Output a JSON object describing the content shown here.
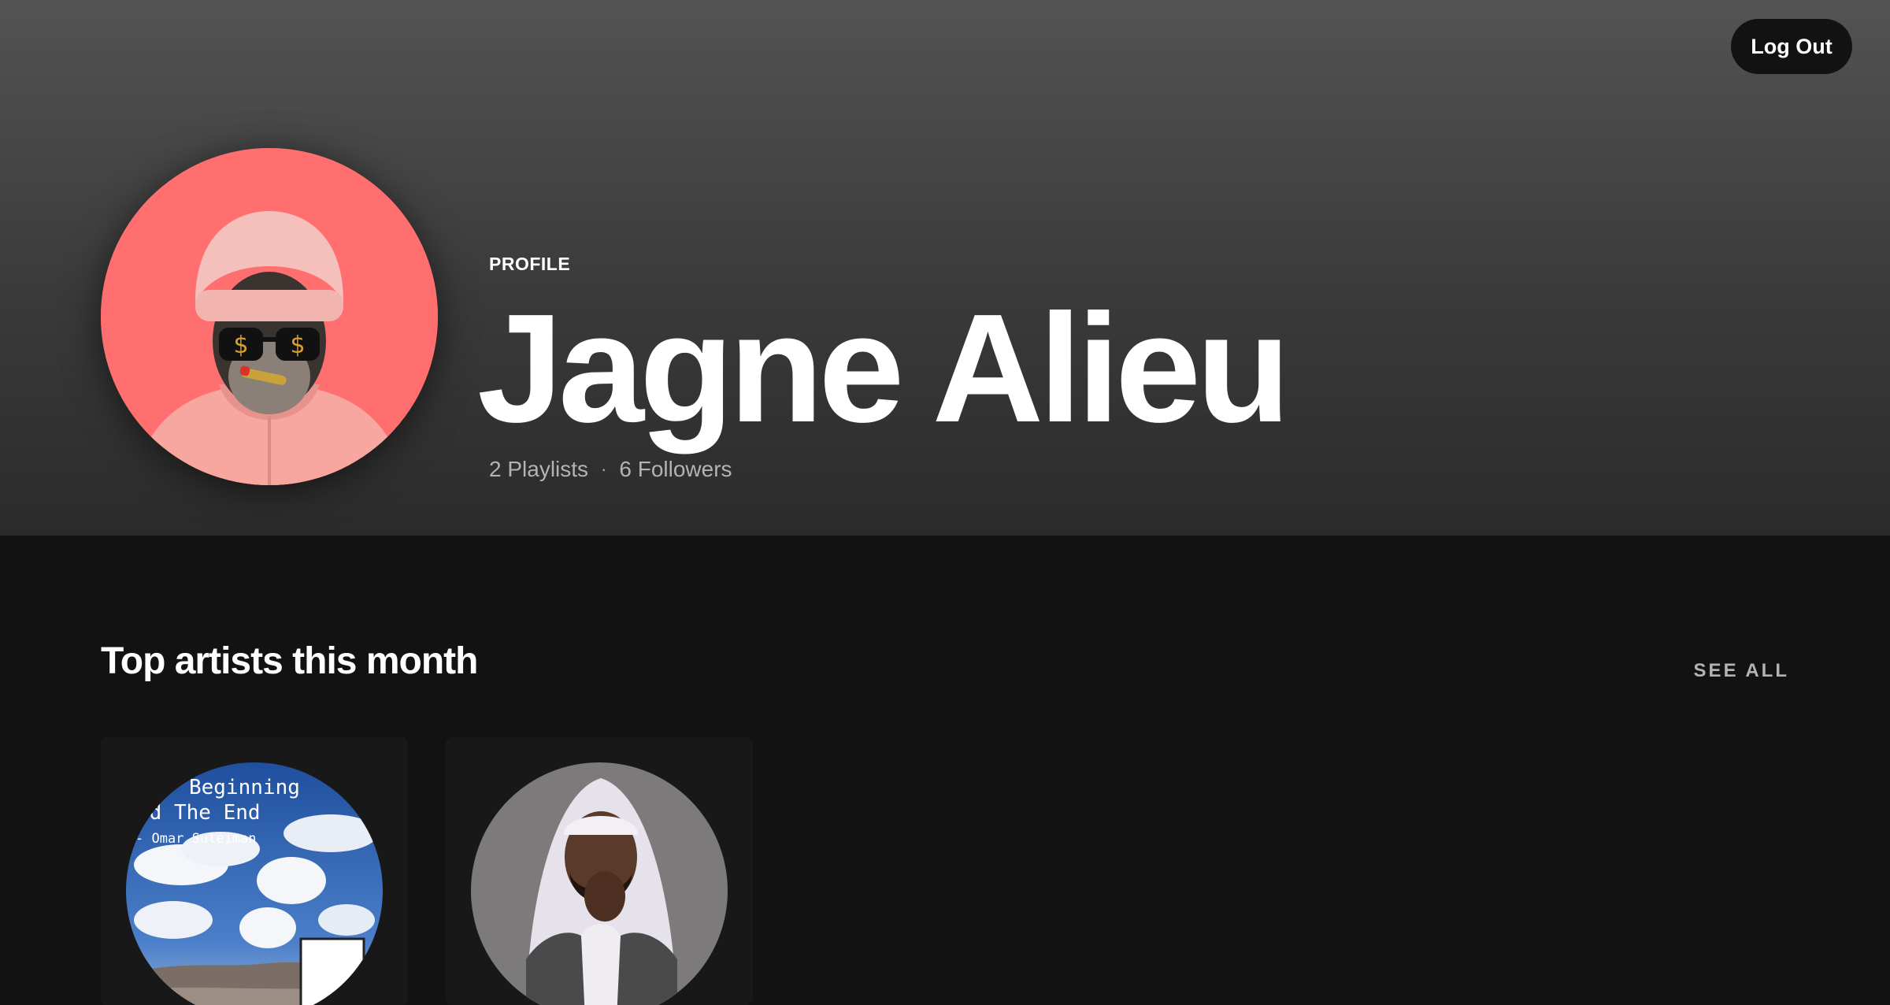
{
  "header": {
    "logout_label": "Log Out",
    "profile_label": "PROFILE",
    "name": "Jagne Alieu",
    "playlists": "2 Playlists",
    "separator": "·",
    "followers": "6 Followers"
  },
  "top_artists": {
    "title": "Top artists this month",
    "see_all": "SEE ALL",
    "artists": [
      {
        "cover_line1": "Beginning",
        "cover_line2": "nd The End",
        "cover_line3": "- Omar Suleiman"
      },
      {}
    ]
  },
  "colors": {
    "background": "#121212",
    "avatar_bg": "#ff6f6f",
    "card_bg": "#181818",
    "muted_text": "#b3b3b3"
  }
}
